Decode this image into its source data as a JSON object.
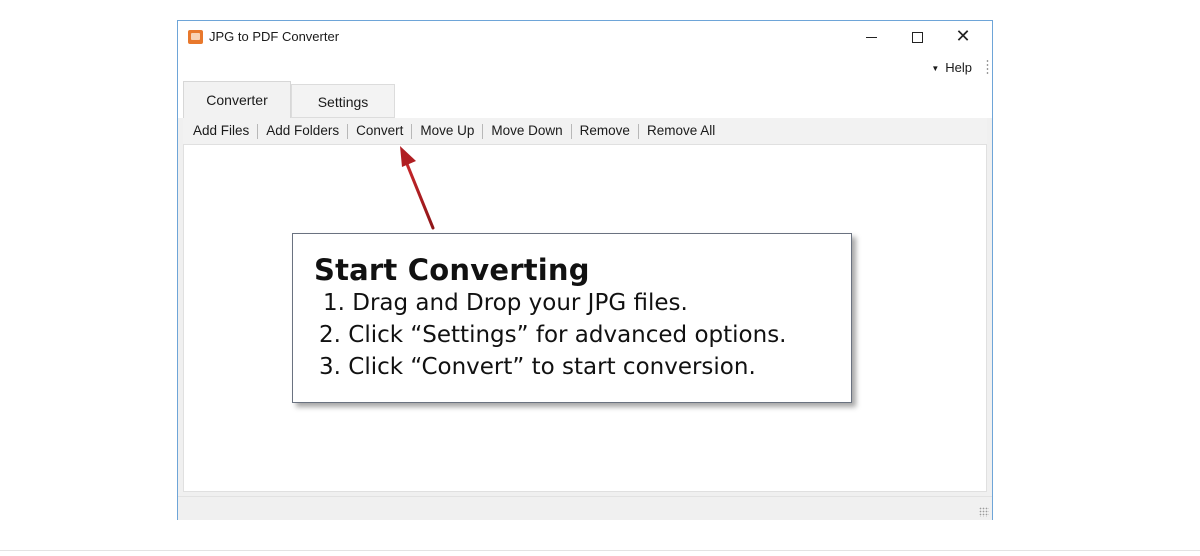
{
  "window": {
    "title": "JPG to PDF Converter"
  },
  "menu": {
    "help_label": "Help"
  },
  "tabs": [
    {
      "label": "Converter",
      "active": true
    },
    {
      "label": "Settings",
      "active": false
    }
  ],
  "toolbar": {
    "items": [
      {
        "label": "Add Files"
      },
      {
        "label": "Add Folders"
      },
      {
        "label": "Convert"
      },
      {
        "label": "Move Up"
      },
      {
        "label": "Move Down"
      },
      {
        "label": "Remove"
      },
      {
        "label": "Remove All"
      }
    ]
  },
  "callout": {
    "title": "Start Converting",
    "steps": [
      "1. Drag and Drop your JPG files.",
      "2. Click “Settings” for advanced options.",
      "3. Click “Convert” to start conversion."
    ]
  },
  "colors": {
    "window_border": "#6ea5d8",
    "app_icon": "#e8782c",
    "arrow": "#b01e22"
  },
  "icons": {
    "app": "app-logo-icon",
    "minimize": "minimize-icon",
    "maximize": "maximize-icon",
    "close": "close-icon",
    "help_caret": "caret-down-icon"
  }
}
